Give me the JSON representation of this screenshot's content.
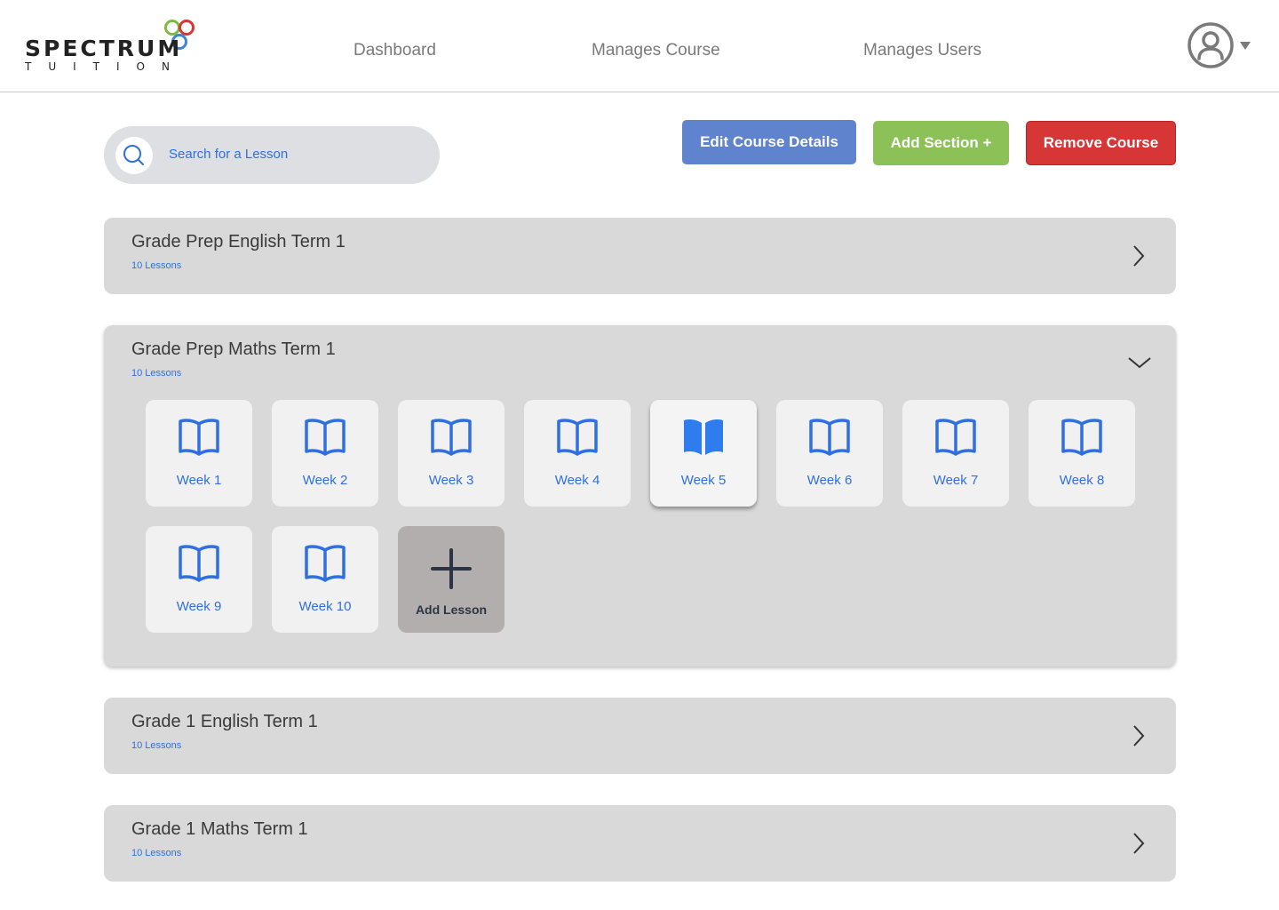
{
  "brand": {
    "name": "SPECTRUM",
    "tagline": "TUITION"
  },
  "nav": {
    "dashboard": "Dashboard",
    "manage_course": "Manages Course",
    "manage_users": "Manages Users"
  },
  "search": {
    "placeholder": "Search for a Lesson"
  },
  "actions": {
    "edit": "Edit Course Details",
    "add_section": "Add Section +",
    "remove": "Remove Course"
  },
  "sections": [
    {
      "title": "Grade Prep English Term 1",
      "count": "10 Lessons",
      "expanded": false
    },
    {
      "title": "Grade Prep Maths Term 1",
      "count": "10 Lessons",
      "expanded": true,
      "lessons": [
        "Week 1",
        "Week 2",
        "Week 3",
        "Week 4",
        "Week 5",
        "Week 6",
        "Week 7",
        "Week 8",
        "Week 9",
        "Week 10"
      ],
      "selected_lesson": "Week 5",
      "add_label": "Add Lesson"
    },
    {
      "title": "Grade 1 English Term 1",
      "count": "10 Lessons",
      "expanded": false
    },
    {
      "title": "Grade 1 Maths Term 1",
      "count": "10 Lessons",
      "expanded": false
    }
  ],
  "colors": {
    "accent_blue": "#2f6fe0",
    "edit_button": "#5f83cc",
    "add_button": "#8cc157",
    "remove_button": "#d63636",
    "section_bg": "#d9d9d9"
  },
  "icons": {
    "search": "search-icon",
    "avatar": "user-avatar-icon",
    "lesson": "book-icon",
    "add": "plus-icon",
    "collapsed": "chevron-right-icon",
    "expanded": "chevron-down-icon"
  }
}
